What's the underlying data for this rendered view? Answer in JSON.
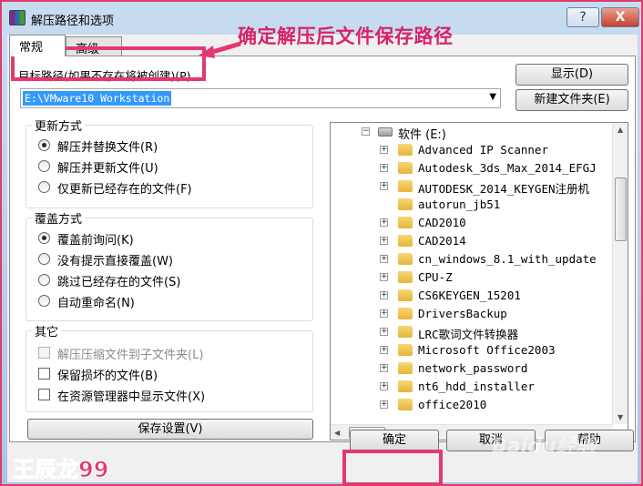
{
  "window": {
    "title": "解压路径和选项",
    "help_glyph": "?",
    "close_glyph": "X"
  },
  "tabs": [
    {
      "label": "常规"
    },
    {
      "label": "高级"
    }
  ],
  "destination": {
    "label": "目标路径(如果不存在将被创建)(P)",
    "value": "E:\\VMware10 Workstation",
    "dropdown_glyph": "▼"
  },
  "annotation": {
    "text": "确定解压后文件保存路径"
  },
  "buttons": {
    "show": "显示(D)",
    "new_folder": "新建文件夹(E)",
    "save_settings": "保存设置(V)",
    "ok": "确定",
    "cancel": "取消",
    "help": "帮助"
  },
  "update_mode": {
    "title": "更新方式",
    "options": [
      {
        "label": "解压并替换文件(R)",
        "selected": true
      },
      {
        "label": "解压并更新文件(U)",
        "selected": false
      },
      {
        "label": "仅更新已经存在的文件(F)",
        "selected": false
      }
    ]
  },
  "overwrite_mode": {
    "title": "覆盖方式",
    "options": [
      {
        "label": "覆盖前询问(K)",
        "selected": true
      },
      {
        "label": "没有提示直接覆盖(W)",
        "selected": false
      },
      {
        "label": "跳过已经存在的文件(S)",
        "selected": false
      },
      {
        "label": "自动重命名(N)",
        "selected": false
      }
    ]
  },
  "misc": {
    "title": "其它",
    "options": [
      {
        "label": "解压压缩文件到子文件夹(L)",
        "checked": false,
        "disabled": true
      },
      {
        "label": "保留损坏的文件(B)",
        "checked": false,
        "disabled": false
      },
      {
        "label": "在资源管理器中显示文件(X)",
        "checked": false,
        "disabled": false
      }
    ]
  },
  "tree": {
    "root": {
      "label": "软件 (E:)",
      "expander": "−"
    },
    "items": [
      {
        "label": "Advanced IP Scanner",
        "expander": "+"
      },
      {
        "label": "Autodesk_3ds_Max_2014_EFGJ",
        "expander": "+"
      },
      {
        "label": "AUTODESK_2014_KEYGEN注册机",
        "expander": "+"
      },
      {
        "label": "autorun_jb51",
        "expander": ""
      },
      {
        "label": "CAD2010",
        "expander": "+"
      },
      {
        "label": "CAD2014",
        "expander": "+"
      },
      {
        "label": "cn_windows_8.1_with_update",
        "expander": "+"
      },
      {
        "label": "CPU-Z",
        "expander": "+"
      },
      {
        "label": "CS6KEYGEN_15201",
        "expander": "+"
      },
      {
        "label": "DriversBackup",
        "expander": "+"
      },
      {
        "label": "LRC歌词文件转换器",
        "expander": "+"
      },
      {
        "label": "Microsoft Office2003",
        "expander": "+"
      },
      {
        "label": "network_password",
        "expander": "+"
      },
      {
        "label": "nt6_hdd_installer",
        "expander": "+"
      },
      {
        "label": "office2010",
        "expander": "+"
      }
    ]
  },
  "watermark": {
    "author": "王辰龙99",
    "site": "Baidu经验"
  },
  "colors": {
    "highlight": "#e33a6e",
    "selection": "#3399ff"
  }
}
